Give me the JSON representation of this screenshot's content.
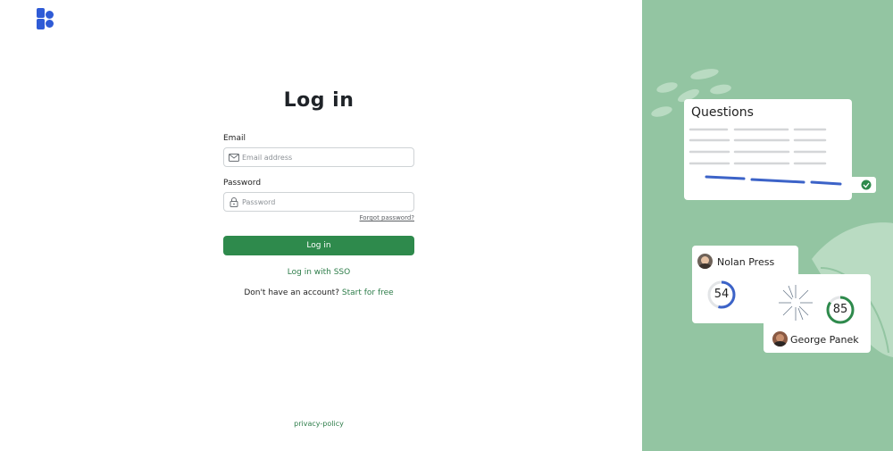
{
  "brand": {
    "logo_icon": "brand-logo-icon",
    "logo_color": "#2f5bd6"
  },
  "form": {
    "title": "Log in",
    "email_label": "Email",
    "email_placeholder": "Email address",
    "password_label": "Password",
    "password_placeholder": "Password",
    "forgot_label": "Forgot password?",
    "submit_label": "Log in",
    "sso_label": "Log in with SSO",
    "no_account_text": "Don't have an account?",
    "signup_link": "Start for free"
  },
  "footer": {
    "privacy_label": "privacy-policy"
  },
  "illustration": {
    "background_color": "#93c5a2",
    "accent_color": "#2e8a4c",
    "questions_card": {
      "title": "Questions"
    },
    "person_one": {
      "name": "Nolan Press",
      "score": "54"
    },
    "person_two": {
      "name": "George Panek",
      "score": "85"
    }
  }
}
